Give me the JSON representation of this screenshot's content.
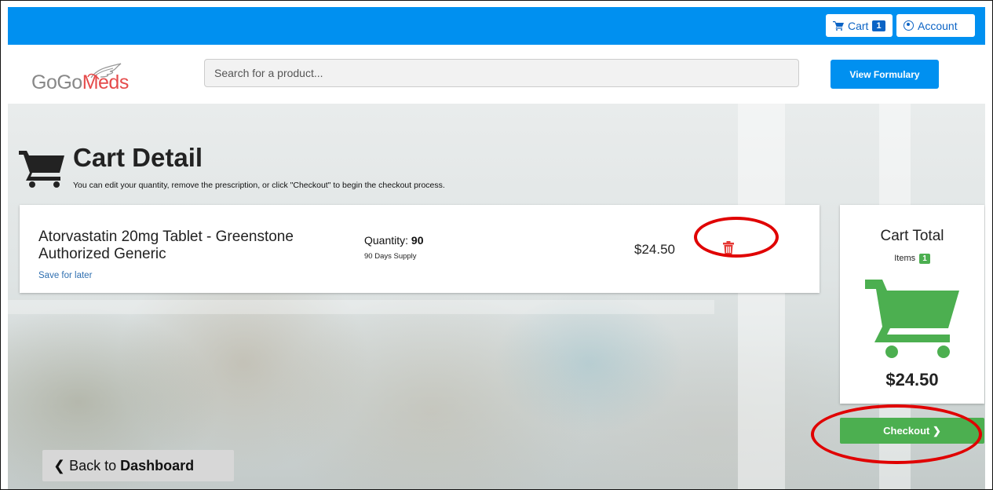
{
  "topbar": {
    "cart_label": "Cart",
    "cart_count": "1",
    "account_label": "Account"
  },
  "header": {
    "logo_part1": "GoGo",
    "logo_part2": "Meds",
    "search_placeholder": "Search for a product...",
    "formulary_label": "View Formulary"
  },
  "page": {
    "title": "Cart Detail",
    "subtitle": "You can edit your quantity, remove the prescription, or click \"Checkout\" to begin the checkout process."
  },
  "cart_item": {
    "name": "Atorvastatin 20mg Tablet - Greenstone Authorized Generic",
    "save_for_later": "Save for later",
    "quantity_label": "Quantity:",
    "quantity_value": "90",
    "supply": "90 Days Supply",
    "price": "$24.50"
  },
  "cart_total": {
    "title": "Cart Total",
    "items_label": "Items",
    "items_count": "1",
    "amount": "$24.50"
  },
  "actions": {
    "checkout_label": "Checkout ❯",
    "back_prefix": "❮ Back to ",
    "back_target": "Dashboard"
  },
  "colors": {
    "brand_blue": "#0090f0",
    "checkout_green": "#4caf50",
    "delete_red": "#e53935",
    "annotation_red": "#e00000"
  },
  "icons": [
    "cart-icon",
    "account-icon",
    "shopping-cart-icon",
    "trash-icon",
    "large-cart-icon",
    "chevron-right-icon",
    "chevron-left-icon"
  ]
}
